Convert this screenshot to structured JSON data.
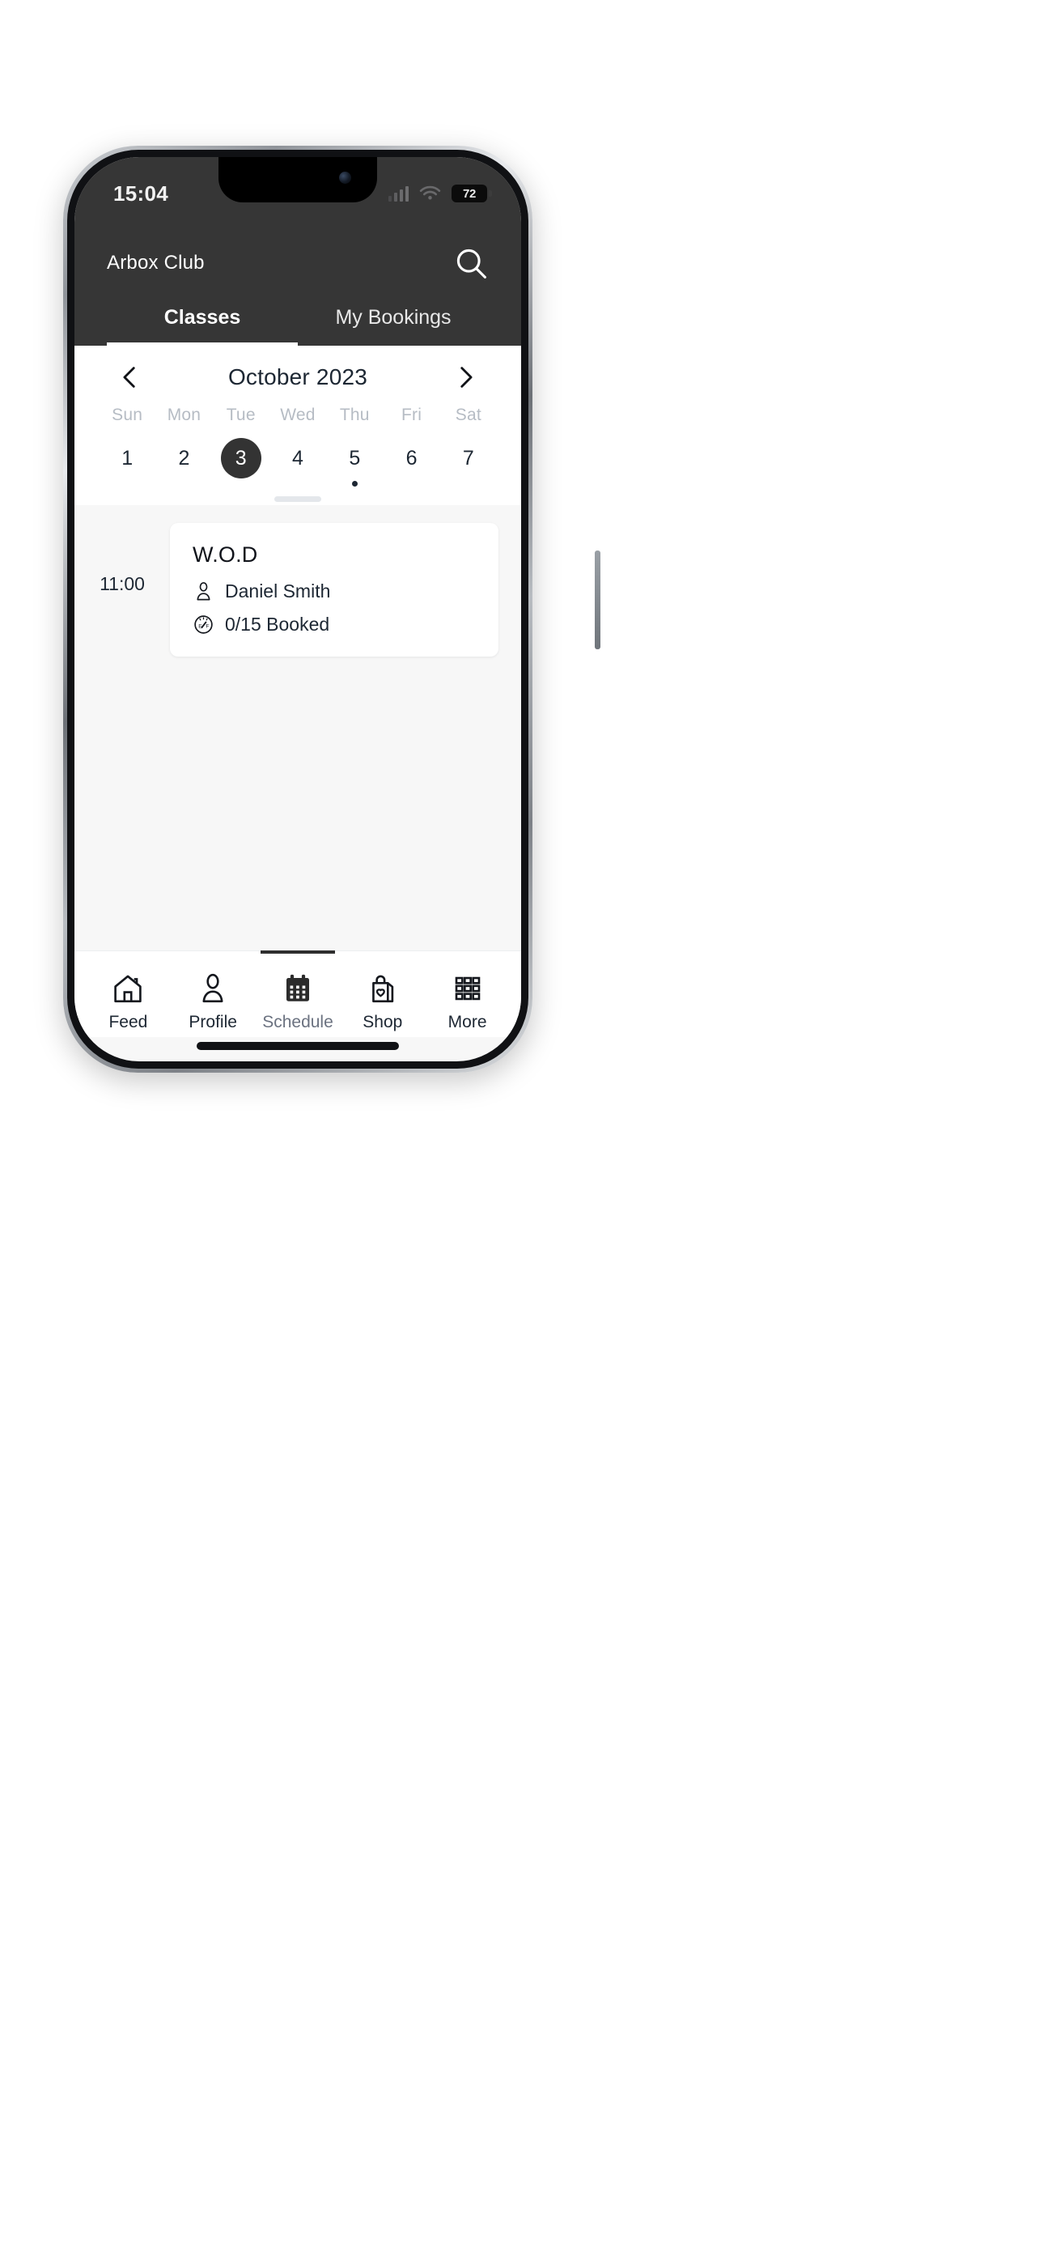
{
  "status_bar": {
    "time": "15:04",
    "battery_level": "72",
    "signal_icon": "cellular-signal-icon",
    "wifi_icon": "wifi-icon",
    "battery_icon": "battery-icon"
  },
  "header": {
    "club_name": "Arbox Club",
    "search_icon": "search-icon"
  },
  "tabs": [
    {
      "label": "Classes",
      "active": true
    },
    {
      "label": "My Bookings",
      "active": false
    }
  ],
  "calendar": {
    "month_label": "October 2023",
    "prev_icon": "chevron-left-icon",
    "next_icon": "chevron-right-icon",
    "day_names": [
      "Sun",
      "Mon",
      "Tue",
      "Wed",
      "Thu",
      "Fri",
      "Sat"
    ],
    "dates": [
      {
        "number": "1",
        "selected": false,
        "has_event_dot": false
      },
      {
        "number": "2",
        "selected": false,
        "has_event_dot": false
      },
      {
        "number": "3",
        "selected": true,
        "has_event_dot": false
      },
      {
        "number": "4",
        "selected": false,
        "has_event_dot": false
      },
      {
        "number": "5",
        "selected": false,
        "has_event_dot": true
      },
      {
        "number": "6",
        "selected": false,
        "has_event_dot": false
      },
      {
        "number": "7",
        "selected": false,
        "has_event_dot": false
      }
    ],
    "selected_color": "#333333"
  },
  "schedule": {
    "classes": [
      {
        "time": "11:00",
        "title": "W.O.D",
        "coach_icon": "person-icon",
        "coach": "Daniel Smith",
        "capacity_icon": "fuel-gauge-icon",
        "capacity": "0/15 Booked"
      }
    ]
  },
  "bottom_nav": [
    {
      "label": "Feed",
      "icon": "home-icon",
      "active": false
    },
    {
      "label": "Profile",
      "icon": "person-icon",
      "active": false
    },
    {
      "label": "Schedule",
      "icon": "calendar-icon",
      "active": true
    },
    {
      "label": "Shop",
      "icon": "shopping-bag-heart-icon",
      "active": false
    },
    {
      "label": "More",
      "icon": "grid-icon",
      "active": false
    }
  ]
}
